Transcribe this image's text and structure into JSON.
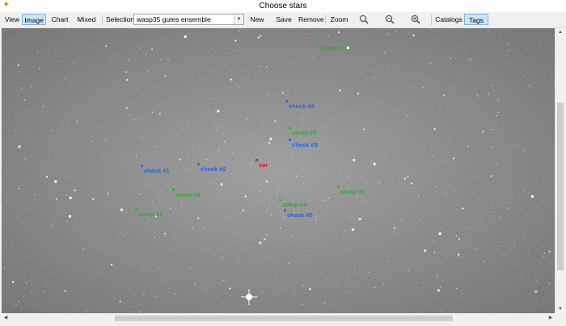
{
  "window": {
    "title": "Choose stars",
    "app_icon": "star-icon"
  },
  "toolbar": {
    "view": "View",
    "image": "Image",
    "chart": "Chart",
    "mixed": "Mixed",
    "selection_label": "Selection",
    "selection_value": "wasp35 gutes ensemble",
    "new": "New",
    "save_as": "Save as...",
    "remove": "Remove",
    "zoom": "Zoom",
    "catalogs": "Catalogs",
    "tags": "Tags",
    "icons": {
      "zoom_fit": "zoom-fit-icon",
      "zoom_out": "zoom-out-icon",
      "zoom_in": "zoom-in-icon"
    }
  },
  "markers": [
    {
      "label": "comp #6",
      "kind": "comp"
    },
    {
      "label": "check #4",
      "kind": "check"
    },
    {
      "label": "comp #5",
      "kind": "comp"
    },
    {
      "label": "check #3",
      "kind": "check"
    },
    {
      "label": "check #1",
      "kind": "check"
    },
    {
      "label": "check #2",
      "kind": "check"
    },
    {
      "label": "var",
      "kind": "var"
    },
    {
      "label": "comp #3",
      "kind": "comp"
    },
    {
      "label": "comp #1",
      "kind": "comp"
    },
    {
      "label": "comp #4",
      "kind": "comp"
    },
    {
      "label": "check #5",
      "kind": "check"
    },
    {
      "label": "comp #2",
      "kind": "comp"
    }
  ],
  "colors": {
    "comp": "#22b52a",
    "check": "#2b63e0",
    "var": "#d6161b",
    "selected_button": "#cde6fb"
  }
}
